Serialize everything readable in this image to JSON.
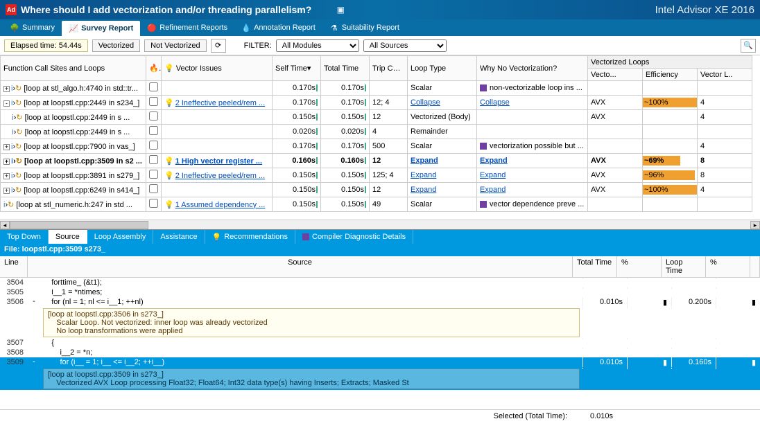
{
  "titlebar": {
    "logo_text": "Ad",
    "title": "Where should I add vectorization and/or threading parallelism?",
    "product": "Intel Advisor XE 2016"
  },
  "navtabs": [
    {
      "icon": "🌳",
      "label": "Summary"
    },
    {
      "icon": "📈",
      "label": "Survey Report",
      "active": true
    },
    {
      "icon": "🔴",
      "label": "Refinement Reports"
    },
    {
      "icon": "💧",
      "label": "Annotation Report"
    },
    {
      "icon": "⚗",
      "label": "Suitability Report"
    }
  ],
  "toolbar": {
    "elapsed": "Elapsed time: 54.44s",
    "btn_vectorized": "Vectorized",
    "btn_not_vectorized": "Not Vectorized",
    "filter_label": "FILTER:",
    "filter_modules": "All Modules",
    "filter_sources": "All Sources"
  },
  "grid_headers": {
    "func": "Function Call Sites and Loops",
    "hot": "",
    "issues": "Vector Issues",
    "self": "Self Time",
    "total": "Total Time",
    "trip": "Trip Counts",
    "loop_type": "Loop Type",
    "why": "Why No Vectorization?",
    "vec_group": "Vectorized Loops",
    "vec": "Vecto...",
    "eff": "Efficiency",
    "vl": "Vector L.."
  },
  "rows": [
    {
      "indent": 0,
      "toggle": "+",
      "icon": "↻",
      "name": "[loop at stl_algo.h:4740 in std::tr...",
      "cb": false,
      "issue": "",
      "self": "0.170s",
      "total": "0.170s",
      "trip": "",
      "type": "Scalar",
      "why_sq": true,
      "why": "non-vectorizable loop ins ...",
      "vec": "",
      "eff": "",
      "vl": ""
    },
    {
      "indent": 0,
      "toggle": "-",
      "icon": "↻",
      "name": "[loop at loopstl.cpp:2449 in s234_]",
      "cb": false,
      "bulb": true,
      "issue": "2 Ineffective peeled/rem ...",
      "issue_link": true,
      "self": "0.170s",
      "total": "0.170s",
      "trip": "12; 4",
      "type_link": true,
      "type": "Collapse",
      "why_link": true,
      "why": "Collapse",
      "vec": "AVX",
      "eff": "~100%",
      "eff_pct": 100,
      "vl": "4"
    },
    {
      "indent": 1,
      "toggle": "",
      "icon": "↻",
      "name": "[loop at loopstl.cpp:2449 in s ...",
      "cb": false,
      "issue": "",
      "self": "0.150s",
      "total": "0.150s",
      "trip": "12",
      "type": "Vectorized (Body)",
      "why": "",
      "vec": "AVX",
      "eff": "",
      "vl": "4"
    },
    {
      "indent": 1,
      "toggle": "",
      "icon": "↻",
      "name": "[loop at loopstl.cpp:2449 in s ...",
      "cb": false,
      "issue": "",
      "self": "0.020s",
      "total": "0.020s",
      "trip": "4",
      "type": "Remainder",
      "why": "",
      "vec": "",
      "eff": "",
      "vl": ""
    },
    {
      "indent": 0,
      "toggle": "+",
      "icon": "↻",
      "name": "[loop at loopstl.cpp:7900 in vas_]",
      "cb": false,
      "issue": "",
      "self": "0.170s",
      "total": "0.170s",
      "trip": "500",
      "type": "Scalar",
      "why_sq": true,
      "why": "vectorization possible but ...",
      "vec": "",
      "eff": "",
      "vl": "4"
    },
    {
      "indent": 0,
      "toggle": "+",
      "icon": "↻",
      "name": "[loop at loopstl.cpp:3509 in s2 ...",
      "bold": true,
      "cb": false,
      "bulb": true,
      "issue": "1 High vector register ...",
      "issue_link": true,
      "self": "0.160s",
      "total": "0.160s",
      "trip": "12",
      "type_link": true,
      "type": "Expand",
      "why_link": true,
      "why": "Expand",
      "vec": "AVX",
      "eff": "~69%",
      "eff_pct": 69,
      "vl": "8"
    },
    {
      "indent": 0,
      "toggle": "+",
      "icon": "↻",
      "name": "[loop at loopstl.cpp:3891 in s279_]",
      "cb": false,
      "bulb": true,
      "issue": "2 Ineffective peeled/rem ...",
      "issue_link": true,
      "self": "0.150s",
      "total": "0.150s",
      "trip": "125; 4",
      "type_link": true,
      "type": "Expand",
      "why_link": true,
      "why": "Expand",
      "vec": "AVX",
      "eff": "~96%",
      "eff_pct": 96,
      "vl": "8"
    },
    {
      "indent": 0,
      "toggle": "+",
      "icon": "↻",
      "name": "[loop at loopstl.cpp:6249 in s414_]",
      "cb": false,
      "issue": "",
      "self": "0.150s",
      "total": "0.150s",
      "trip": "12",
      "type_link": true,
      "type": "Expand",
      "why_link": true,
      "why": "Expand",
      "vec": "AVX",
      "eff": "~100%",
      "eff_pct": 100,
      "vl": "4"
    },
    {
      "indent": 0,
      "toggle": "",
      "icon": "↻",
      "name": "[loop at stl_numeric.h:247 in std ...",
      "cb": false,
      "bulb": true,
      "issue": "1 Assumed dependency ...",
      "issue_link": true,
      "self": "0.150s",
      "total": "0.150s",
      "trip": "49",
      "type": "Scalar",
      "why_sq": true,
      "why": "vector dependence preve ...",
      "vec": "",
      "eff": "",
      "vl": ""
    }
  ],
  "bottom_tabs": [
    {
      "label": "Top Down"
    },
    {
      "label": "Source",
      "active": true
    },
    {
      "label": "Loop Assembly"
    },
    {
      "label": "Assistance"
    },
    {
      "label": "Recommendations",
      "bulb": true
    },
    {
      "label": "Compiler Diagnostic Details",
      "purple": true
    }
  ],
  "filebar": "File: loopstl.cpp:3509 s273_",
  "source_headers": {
    "line": "Line",
    "source": "Source",
    "total": "Total Time",
    "pct1": "%",
    "loop": "Loop Time",
    "pct2": "%"
  },
  "source_rows": [
    {
      "line": "3504",
      "code": "    forttime_ (&t1);"
    },
    {
      "line": "3505",
      "code": "    i__1 = *ntimes;"
    },
    {
      "line": "3506",
      "toggle": "-",
      "code": "    for (nl = 1; nl <= i__1; ++nl)",
      "total": "0.010s",
      "loop": "0.200s"
    },
    {
      "annotation": "[loop at loopstl.cpp:3506 in s273_]\n    Scalar Loop. Not vectorized: inner loop was already vectorized\n    No loop transformations were applied"
    },
    {
      "line": "3507",
      "code": "    {"
    },
    {
      "line": "3508",
      "code": "        i__2 = *n;"
    },
    {
      "line": "3509",
      "toggle": "-",
      "highlight": true,
      "code": "        for (i__ = 1; i__ <= i__2; ++i__)",
      "total": "0.010s",
      "loop": "0.160s"
    },
    {
      "annotation": "[loop at loopstl.cpp:3509 in s273_]\n    Vectorized AVX Loop processing Float32; Float64; Int32 data type(s) having Inserts; Extracts; Masked St",
      "highlight": true
    }
  ],
  "statusbar": {
    "label": "Selected (Total Time):",
    "value": "0.010s"
  }
}
